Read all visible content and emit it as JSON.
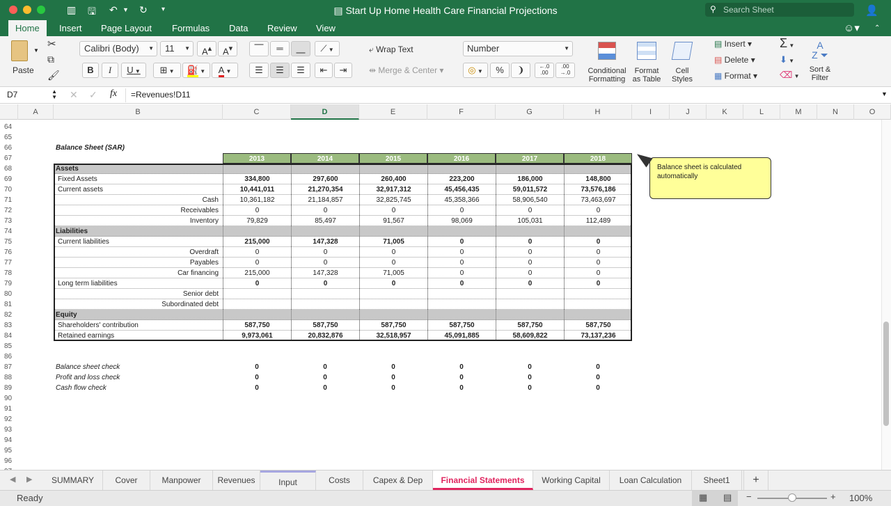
{
  "window": {
    "title": "Start Up Home Health Care Financial Projections",
    "search_placeholder": "Search Sheet"
  },
  "ribbon_tabs": [
    "Home",
    "Insert",
    "Page Layout",
    "Formulas",
    "Data",
    "Review",
    "View"
  ],
  "ribbon": {
    "paste": "Paste",
    "font_name": "Calibri (Body)",
    "font_size": "11",
    "bold": "B",
    "italic": "I",
    "underline": "U",
    "wrap_text": "Wrap Text",
    "merge_center": "Merge & Center",
    "number_format": "Number",
    "percent": "%",
    "comma": "❩",
    "inc_decimal": "←.0 .00",
    "dec_decimal": ".00 →.0",
    "conditional_formatting": [
      "Conditional",
      "Formatting"
    ],
    "format_as_table": [
      "Format",
      "as Table"
    ],
    "cell_styles": [
      "Cell",
      "Styles"
    ],
    "insert": "Insert",
    "delete": "Delete",
    "format": "Format",
    "sort_filter": [
      "Sort &",
      "Filter"
    ],
    "autosum": "Σ"
  },
  "formula_bar": {
    "name_box": "D7",
    "formula": "=Revenues!D11"
  },
  "columns": [
    "A",
    "B",
    "C",
    "D",
    "E",
    "F",
    "G",
    "H",
    "I",
    "J",
    "K",
    "L",
    "M",
    "N",
    "O"
  ],
  "rows": [
    "64",
    "65",
    "66",
    "67",
    "68",
    "69",
    "70",
    "71",
    "72",
    "73",
    "74",
    "75",
    "76",
    "77",
    "78",
    "79",
    "80",
    "81",
    "82",
    "83",
    "84",
    "85",
    "86",
    "87",
    "88",
    "89",
    "90",
    "91",
    "92",
    "93",
    "94",
    "95",
    "96",
    "97"
  ],
  "sheet": {
    "title": "Balance Sheet (SAR)",
    "years": [
      "2013",
      "2014",
      "2015",
      "2016",
      "2017",
      "2018"
    ],
    "table_rows": [
      {
        "label": "Assets",
        "type": "section",
        "values": [
          "",
          "",
          "",
          "",
          "",
          ""
        ]
      },
      {
        "label": "Fixed Assets",
        "type": "bold",
        "values": [
          "334,800",
          "297,600",
          "260,400",
          "223,200",
          "186,000",
          "148,800"
        ]
      },
      {
        "label": "Current assets",
        "type": "bold",
        "values": [
          "10,441,011",
          "21,270,354",
          "32,917,312",
          "45,456,435",
          "59,011,572",
          "73,576,186"
        ]
      },
      {
        "label": "Cash",
        "type": "sub",
        "values": [
          "10,361,182",
          "21,184,857",
          "32,825,745",
          "45,358,366",
          "58,906,540",
          "73,463,697"
        ]
      },
      {
        "label": "Receivables",
        "type": "sub",
        "values": [
          "0",
          "0",
          "0",
          "0",
          "0",
          "0"
        ]
      },
      {
        "label": "Inventory",
        "type": "sub",
        "values": [
          "79,829",
          "85,497",
          "91,567",
          "98,069",
          "105,031",
          "112,489"
        ]
      },
      {
        "label": "Liabilities",
        "type": "section",
        "values": [
          "",
          "",
          "",
          "",
          "",
          ""
        ]
      },
      {
        "label": "Current liabilities",
        "type": "bold",
        "values": [
          "215,000",
          "147,328",
          "71,005",
          "0",
          "0",
          "0"
        ]
      },
      {
        "label": "Overdraft",
        "type": "sub",
        "values": [
          "0",
          "0",
          "0",
          "0",
          "0",
          "0"
        ]
      },
      {
        "label": "Payables",
        "type": "sub",
        "values": [
          "0",
          "0",
          "0",
          "0",
          "0",
          "0"
        ]
      },
      {
        "label": "Car financing",
        "type": "sub",
        "values": [
          "215,000",
          "147,328",
          "71,005",
          "0",
          "0",
          "0"
        ]
      },
      {
        "label": "Long term liabilities",
        "type": "bold",
        "values": [
          "0",
          "0",
          "0",
          "0",
          "0",
          "0"
        ]
      },
      {
        "label": "Senior debt",
        "type": "sub",
        "values": [
          "",
          "",
          "",
          "",
          "",
          ""
        ]
      },
      {
        "label": "Subordinated debt",
        "type": "sub",
        "values": [
          "",
          "",
          "",
          "",
          "",
          ""
        ]
      },
      {
        "label": "Equity",
        "type": "section",
        "values": [
          "",
          "",
          "",
          "",
          "",
          ""
        ]
      },
      {
        "label": "Shareholders' contribution",
        "type": "bold",
        "values": [
          "587,750",
          "587,750",
          "587,750",
          "587,750",
          "587,750",
          "587,750"
        ]
      },
      {
        "label": "Retained earnings",
        "type": "bold",
        "values": [
          "9,973,061",
          "20,832,876",
          "32,518,957",
          "45,091,885",
          "58,609,822",
          "73,137,236"
        ]
      }
    ],
    "checks": [
      {
        "label": "Balance sheet check",
        "values": [
          "0",
          "0",
          "0",
          "0",
          "0",
          "0"
        ]
      },
      {
        "label": "Profit and loss check",
        "values": [
          "0",
          "0",
          "0",
          "0",
          "0",
          "0"
        ]
      },
      {
        "label": "Cash flow check",
        "values": [
          "0",
          "0",
          "0",
          "0",
          "0",
          "0"
        ]
      }
    ],
    "comment": "Balance sheet is calculated automatically"
  },
  "sheet_tabs": [
    "SUMMARY",
    "Cover",
    "Manpower",
    "Revenues",
    "Input",
    "Costs",
    "Capex & Dep",
    "Financial Statements",
    "Working Capital",
    "Loan Calculation",
    "Sheet1"
  ],
  "status": {
    "ready": "Ready",
    "zoom": "100%"
  },
  "colors": {
    "excel_green": "#217346",
    "header_green": "#9bbb7f",
    "section_gray": "#c8c8c8",
    "comment_yellow": "#ffff99",
    "active_tab": "#e0245e"
  }
}
